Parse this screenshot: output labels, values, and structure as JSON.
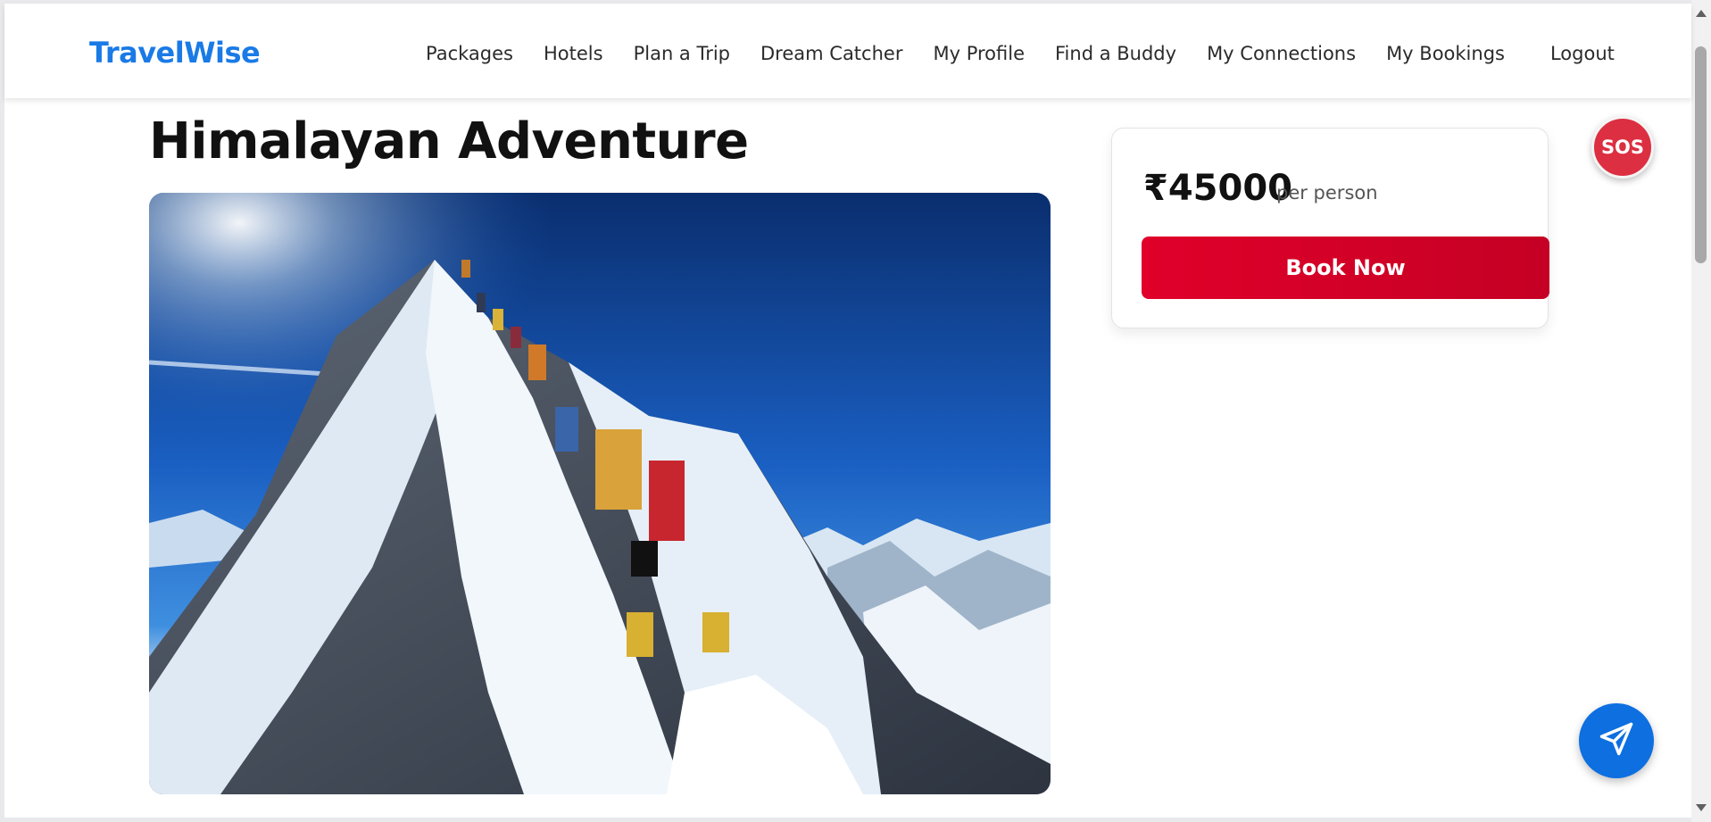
{
  "app": {
    "brand": "TravelWise"
  },
  "nav": {
    "items": [
      {
        "label": "Packages"
      },
      {
        "label": "Hotels"
      },
      {
        "label": "Plan a Trip"
      },
      {
        "label": "Dream Catcher"
      },
      {
        "label": "My Profile"
      },
      {
        "label": "Find a Buddy"
      },
      {
        "label": "My Connections"
      },
      {
        "label": "My Bookings"
      }
    ],
    "logout_label": "Logout"
  },
  "package": {
    "title": "Himalayan Adventure",
    "image_alt": "Climbers ascending a snowy Himalayan ridge",
    "price": "₹45000",
    "price_unit": "per person",
    "book_label": "Book Now"
  },
  "floating": {
    "sos_label": "SOS",
    "send_icon": "send-icon"
  },
  "colors": {
    "brand": "#1a7ae6",
    "book_button": "#e0002a",
    "sos": "#dc2f41",
    "fab": "#0d6fe0"
  }
}
